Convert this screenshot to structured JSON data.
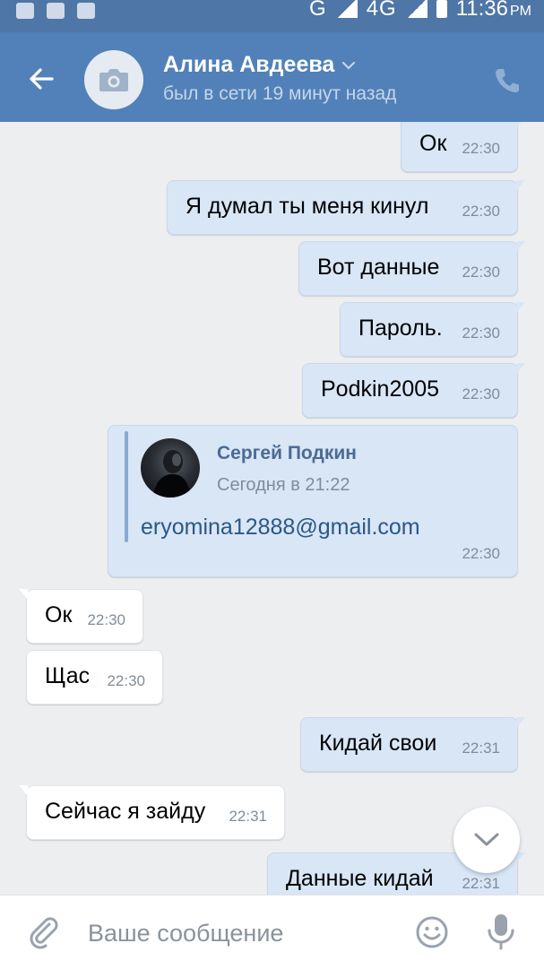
{
  "status_bar": {
    "network": "G",
    "network2": "4G",
    "time": "11:36",
    "ampm": "PM"
  },
  "header": {
    "name": "Алина Авдеева",
    "status": "был в сети 19 минут назад",
    "accent": "#5181b8"
  },
  "messages": [
    {
      "dir": "out",
      "text": "Ок",
      "time": "22:30"
    },
    {
      "dir": "out",
      "text": "Я думал ты меня кинул",
      "time": "22:30"
    },
    {
      "dir": "out",
      "text": "Вот данные",
      "time": "22:30"
    },
    {
      "dir": "out",
      "text": "Пароль.",
      "time": "22:30"
    },
    {
      "dir": "out",
      "text": "Podkin2005",
      "time": "22:30"
    },
    {
      "dir": "out",
      "type": "forward",
      "author": "Сергей Подкин",
      "date": "Сегодня в 21:22",
      "text": "eryomina12888@gmail.com",
      "time": "22:30"
    },
    {
      "dir": "in",
      "text": "Ок",
      "time": "22:30"
    },
    {
      "dir": "in",
      "text": "Щас",
      "time": "22:30"
    },
    {
      "dir": "out",
      "text": "Кидай свои",
      "time": "22:31"
    },
    {
      "dir": "in",
      "text": "Сейчас я зайду",
      "time": "22:31"
    },
    {
      "dir": "out",
      "text": "Данные кидай",
      "time": "22:31"
    }
  ],
  "composer": {
    "placeholder": "Ваше сообщение"
  },
  "icons": {
    "back": "arrow-left-icon",
    "avatar": "camera-icon",
    "call": "phone-icon",
    "attach": "paperclip-icon",
    "emoji": "smiley-icon",
    "mic": "microphone-icon",
    "scroll": "chevron-down-icon"
  }
}
